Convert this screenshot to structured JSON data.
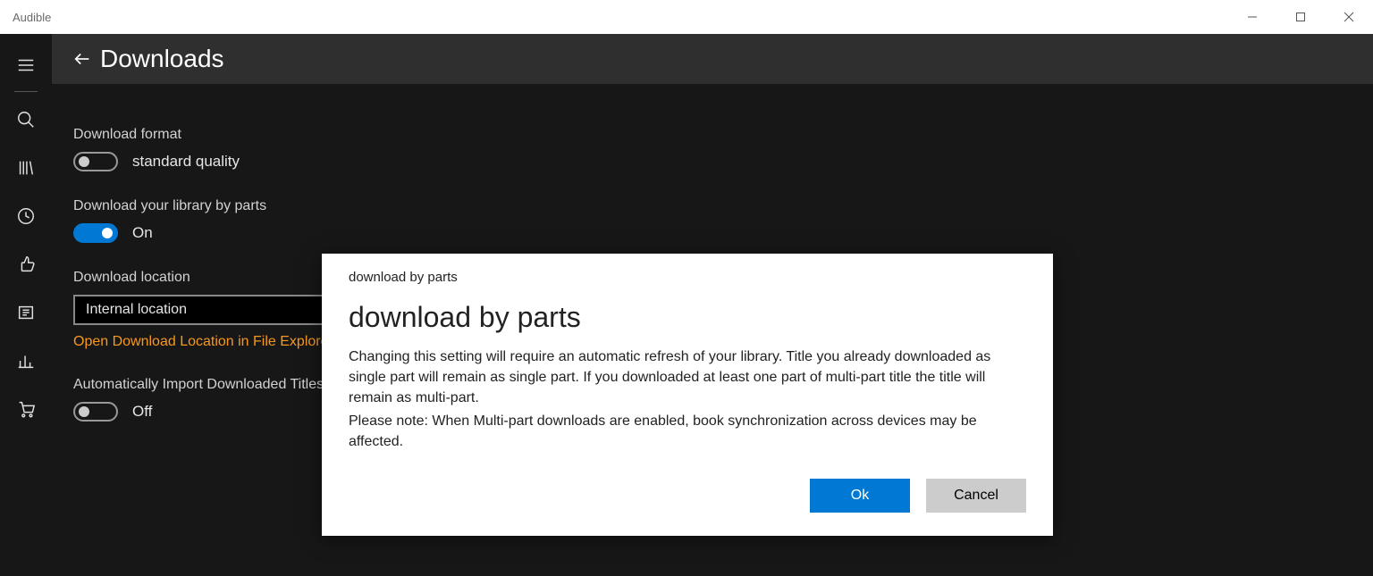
{
  "window": {
    "title": "Audible"
  },
  "header": {
    "title": "Downloads"
  },
  "settings": {
    "download_format": {
      "label": "Download format",
      "value": "standard quality",
      "toggle_on": false
    },
    "by_parts": {
      "label": "Download your library by parts",
      "value": "On",
      "toggle_on": true
    },
    "location": {
      "label": "Download location",
      "value": "Internal location",
      "link": "Open Download Location in File Explorer"
    },
    "auto_import": {
      "label": "Automatically Import Downloaded Titles",
      "value": "Off",
      "toggle_on": false
    }
  },
  "dialog": {
    "caption": "download by parts",
    "title": "download by parts",
    "paragraph1": "Changing this setting will require an automatic refresh of your library. Title you already downloaded as single part will remain as single part. If you downloaded at least one part of multi-part title the title will remain as multi-part.",
    "paragraph2": "Please note: When Multi-part downloads are enabled, book synchronization across devices may be affected.",
    "ok": "Ok",
    "cancel": "Cancel"
  }
}
